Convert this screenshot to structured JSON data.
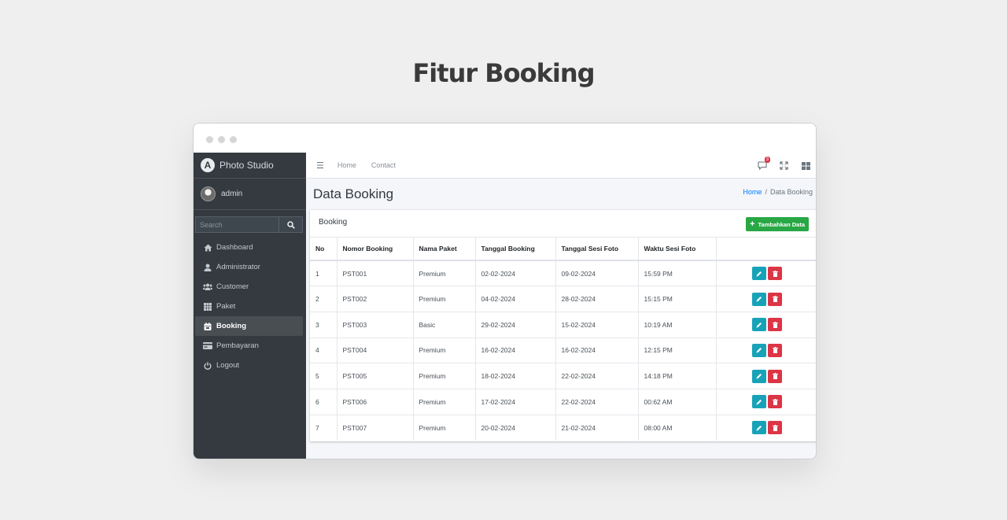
{
  "heading": "Fitur Booking",
  "sidebar": {
    "brand": "Photo Studio",
    "user": "admin",
    "search_placeholder": "Search",
    "items": [
      {
        "label": "Dashboard",
        "icon": "home-icon"
      },
      {
        "label": "Administrator",
        "icon": "user-icon"
      },
      {
        "label": "Customer",
        "icon": "users-icon"
      },
      {
        "label": "Paket",
        "icon": "grid-icon"
      },
      {
        "label": "Booking",
        "icon": "calendar-icon",
        "active": true
      },
      {
        "label": "Pembayaran",
        "icon": "credit-card-icon"
      },
      {
        "label": "Logout",
        "icon": "power-icon"
      }
    ]
  },
  "topnav": {
    "home": "Home",
    "contact": "Contact",
    "notification_count": "3"
  },
  "content": {
    "title": "Data Booking",
    "breadcrumb_home": "Home",
    "breadcrumb_sep": "/",
    "breadcrumb_current": "Data Booking"
  },
  "card": {
    "title": "Booking",
    "add_label": "Tambahkan Data"
  },
  "table": {
    "headers": [
      "No",
      "Nomor Booking",
      "Nama Paket",
      "Tanggal Booking",
      "Tanggal Sesi Foto",
      "Waktu Sesi Foto",
      ""
    ],
    "rows": [
      [
        "1",
        "PST001",
        "Premium",
        "02-02-2024",
        "09-02-2024",
        "15:59 PM"
      ],
      [
        "2",
        "PST002",
        "Premium",
        "04-02-2024",
        "28-02-2024",
        "15:15 PM"
      ],
      [
        "3",
        "PST003",
        "Basic",
        "29-02-2024",
        "15-02-2024",
        "10:19 AM"
      ],
      [
        "4",
        "PST004",
        "Premium",
        "16-02-2024",
        "16-02-2024",
        "12:15 PM"
      ],
      [
        "5",
        "PST005",
        "Premium",
        "18-02-2024",
        "22-02-2024",
        "14:18 PM"
      ],
      [
        "6",
        "PST006",
        "Premium",
        "17-02-2024",
        "22-02-2024",
        "00:62 AM"
      ],
      [
        "7",
        "PST007",
        "Premium",
        "20-02-2024",
        "21-02-2024",
        "08:00 AM"
      ]
    ]
  },
  "colors": {
    "sidebar_bg": "#343a40",
    "edit": "#17a2b8",
    "delete": "#dc3545",
    "add": "#28a745",
    "link": "#007bff"
  }
}
